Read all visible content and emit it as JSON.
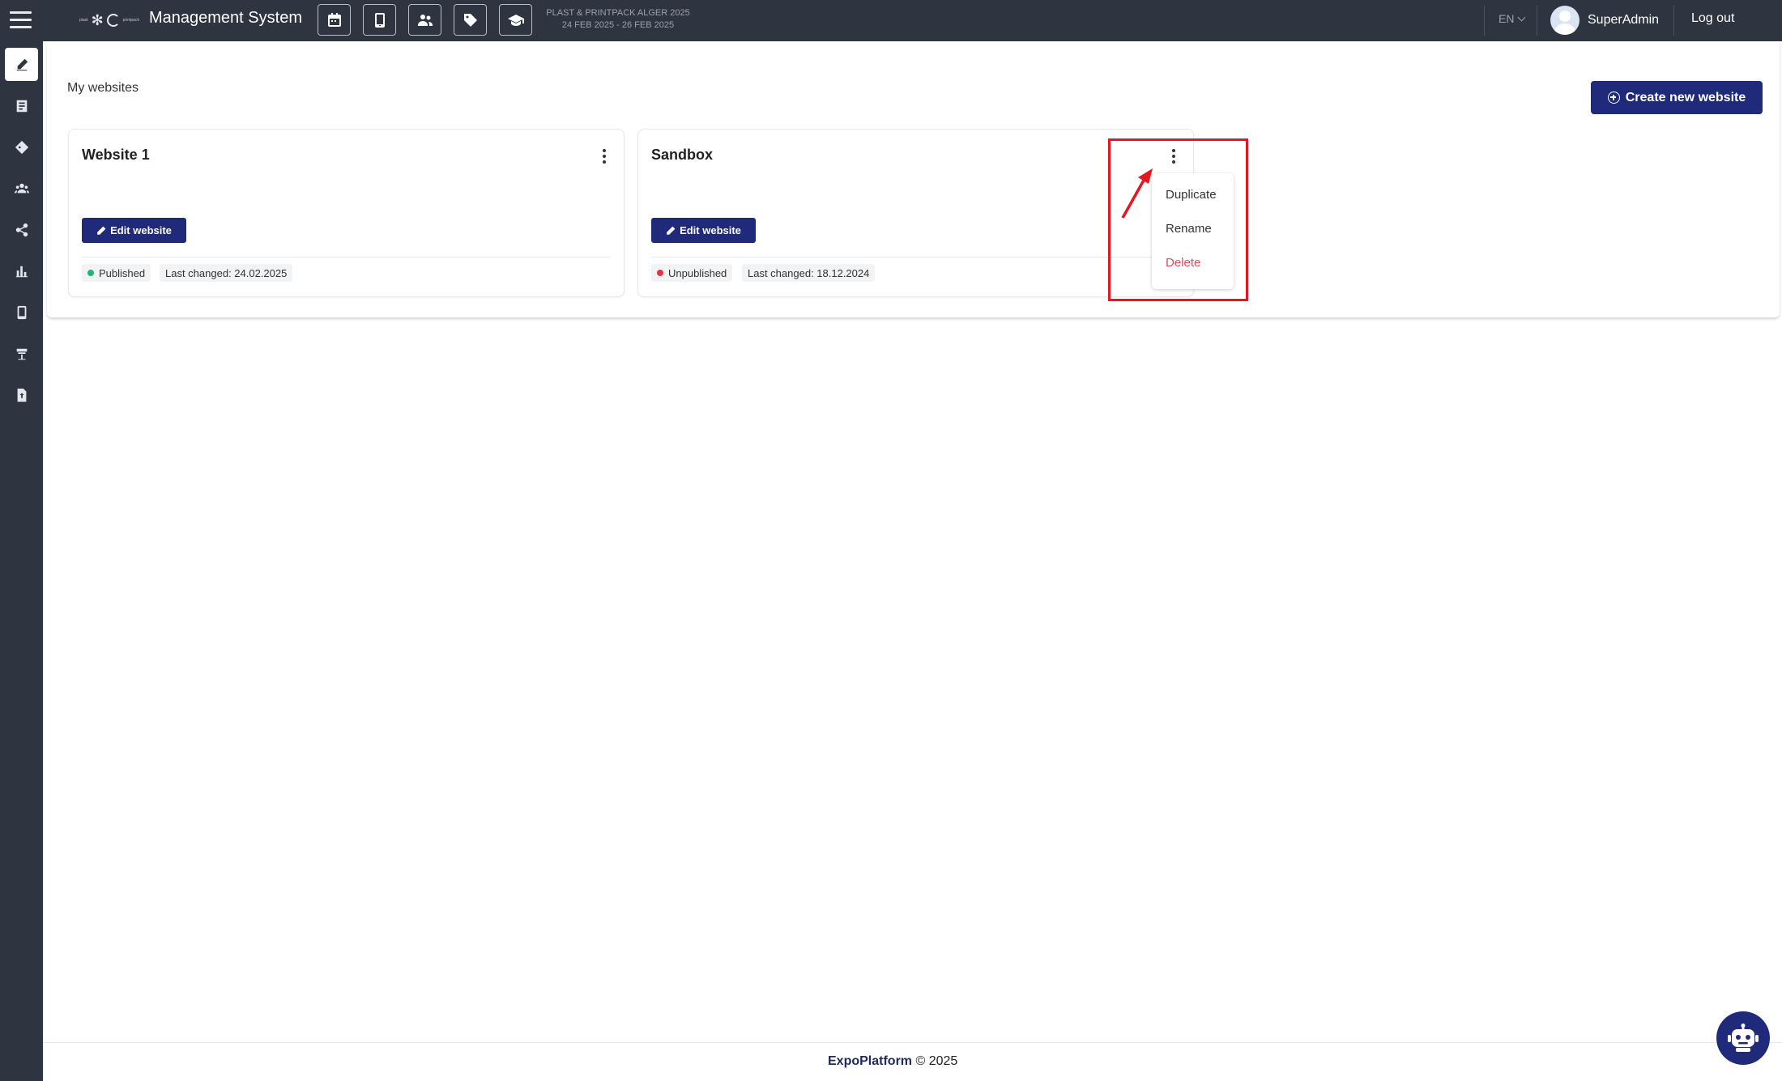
{
  "header": {
    "app_title": "Management System",
    "event_name": "PLAST & PRINTPACK ALGER 2025",
    "event_dates": "24 FEB 2025 - 26 FEB 2025",
    "language": "EN",
    "user_name": "SuperAdmin",
    "logout_label": "Log out",
    "quick_actions": [
      {
        "icon": "calendar-icon"
      },
      {
        "icon": "mobile-icon"
      },
      {
        "icon": "users-icon"
      },
      {
        "icon": "tag-icon"
      },
      {
        "icon": "graduation-cap-icon"
      }
    ]
  },
  "sidebar": {
    "items": [
      {
        "icon": "pencil-icon",
        "active": true
      },
      {
        "icon": "list-icon"
      },
      {
        "icon": "tag-icon"
      },
      {
        "icon": "people-icon"
      },
      {
        "icon": "share-icon"
      },
      {
        "icon": "bar-chart-icon"
      },
      {
        "icon": "mobile-icon"
      },
      {
        "icon": "booth-icon"
      },
      {
        "icon": "file-upload-icon"
      }
    ]
  },
  "main": {
    "section_title": "My websites",
    "create_button": "Create new website",
    "websites": [
      {
        "title": "Website 1",
        "edit_label": "Edit website",
        "status": "Published",
        "status_color": "#22b573",
        "last_changed": "Last changed: 24.02.2025"
      },
      {
        "title": "Sandbox",
        "edit_label": "Edit website",
        "status": "Unpublished",
        "status_color": "#e8324a",
        "last_changed": "Last changed: 18.12.2024"
      }
    ]
  },
  "context_menu": {
    "items": [
      {
        "label": "Duplicate"
      },
      {
        "label": "Rename"
      },
      {
        "label": "Delete",
        "danger": true
      }
    ]
  },
  "footer": {
    "brand": "ExpoPlatform",
    "copyright": "© 2025"
  },
  "colors": {
    "topbar": "#2f3441",
    "accent": "#1f2a7a",
    "danger": "#e84a5f",
    "annotation": "#e5161f"
  }
}
